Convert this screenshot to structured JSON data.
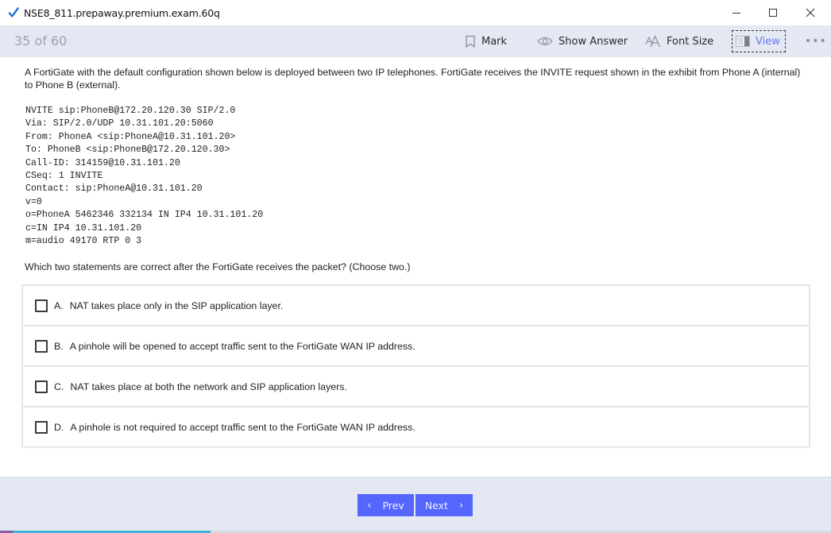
{
  "window": {
    "title": "NSE8_811.prepaway.premium.exam.60q",
    "controls": [
      "minimize",
      "maximize",
      "close"
    ]
  },
  "toolbar": {
    "question_counter": "35 of 60",
    "mark_label": "Mark",
    "show_answer_label": "Show Answer",
    "font_size_label": "Font Size",
    "view_label": "View",
    "more_label": "•••",
    "accent_color": "#6677ee"
  },
  "question": {
    "text": "A FortiGate with the default configuration shown below is deployed between two IP telephones. FortiGate receives the INVITE request shown in the exhibit from Phone A (internal) to Phone B (external).",
    "exhibit_lines": [
      "NVITE sip:PhoneB@172.20.120.30 SIP/2.0",
      "Via: SIP/2.0/UDP 10.31.101.20:5060",
      "From: PhoneA <sip:PhoneA@10.31.101.20>",
      "To: PhoneB <sip:PhoneB@172.20.120.30>",
      "Call-ID: 314159@10.31.101.20",
      "CSeq: 1 INVITE",
      "Contact: sip:PhoneA@10.31.101.20",
      "v=0",
      "o=PhoneA 5462346 332134 IN IP4 10.31.101.20",
      "c=IN IP4 10.31.101.20",
      "m=audio 49170 RTP 0 3"
    ],
    "prompt": "Which two statements are correct after the FortiGate receives the packet? (Choose two.)",
    "options": [
      {
        "letter": "A.",
        "text": "NAT takes place only in the SIP application layer.",
        "checked": false
      },
      {
        "letter": "B.",
        "text": "A pinhole will be opened to accept traffic sent to the FortiGate WAN IP address.",
        "checked": false
      },
      {
        "letter": "C.",
        "text": "NAT takes place at both the network and SIP application layers.",
        "checked": false
      },
      {
        "letter": "D.",
        "text": "A pinhole is not required to accept traffic sent to the FortiGate WAN IP address.",
        "checked": false
      }
    ]
  },
  "footer": {
    "prev_label": "Prev",
    "next_label": "Next",
    "prev_icon": "‹",
    "next_icon": "›",
    "button_color": "#5566ff"
  }
}
